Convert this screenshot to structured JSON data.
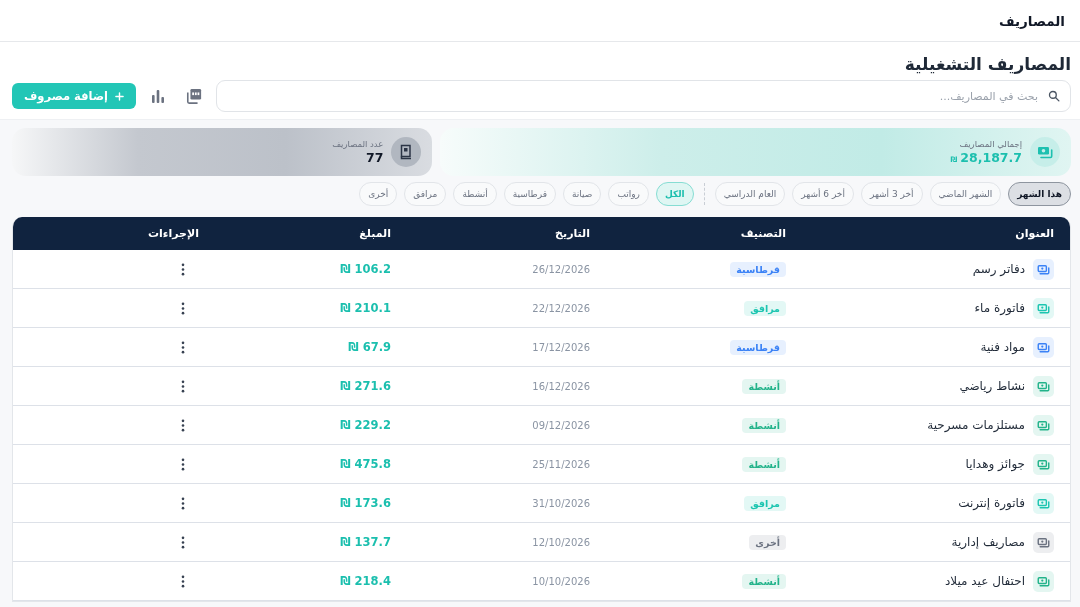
{
  "top_bar": {
    "title": "المصاريف"
  },
  "page": {
    "title": "المصاريف التشغيلية"
  },
  "toolbar": {
    "search": {
      "placeholder": "بحث في المصاريف..."
    },
    "add_button": "إضافة مصروف"
  },
  "stats": [
    {
      "kind": "total",
      "label": "إجمالي المصاريف",
      "value": "28,187.7",
      "currency": "₪"
    },
    {
      "kind": "count",
      "label": "عدد المصاريف",
      "value": "77"
    }
  ],
  "period_filters": [
    {
      "label": "هذا الشهر",
      "selected": true
    },
    {
      "label": "الشهر الماضي",
      "selected": false
    },
    {
      "label": "أخر 3 أشهر",
      "selected": false
    },
    {
      "label": "أخر 6 أشهر",
      "selected": false
    },
    {
      "label": "العام الدراسي",
      "selected": false
    }
  ],
  "category_filters": [
    {
      "label": "الكل",
      "selected": true
    },
    {
      "label": "رواتب",
      "selected": false
    },
    {
      "label": "صيانة",
      "selected": false
    },
    {
      "label": "قرطاسية",
      "selected": false
    },
    {
      "label": "أنشطة",
      "selected": false
    },
    {
      "label": "مرافق",
      "selected": false
    },
    {
      "label": "أخرى",
      "selected": false
    }
  ],
  "table": {
    "columns": [
      "العنوان",
      "التصنيف",
      "التاريخ",
      "المبلغ",
      "الإجراءات"
    ],
    "rows": [
      {
        "title": "دفاتر رسم",
        "category": "قرطاسية",
        "color": "#3b82f6",
        "date": "26/12/2026",
        "amount": "106.2 ₪"
      },
      {
        "title": "فاتورة ماء",
        "category": "مرافق",
        "color": "#1cc5b0",
        "date": "22/12/2026",
        "amount": "210.1 ₪"
      },
      {
        "title": "مواد فنية",
        "category": "قرطاسية",
        "color": "#3b82f6",
        "date": "17/12/2026",
        "amount": "67.9 ₪"
      },
      {
        "title": "نشاط رياضي",
        "category": "أنشطة",
        "color": "#22b38a",
        "date": "16/12/2026",
        "amount": "271.6 ₪"
      },
      {
        "title": "مستلزمات مسرحية",
        "category": "أنشطة",
        "color": "#22b38a",
        "date": "09/12/2026",
        "amount": "229.2 ₪"
      },
      {
        "title": "جوائز وهدايا",
        "category": "أنشطة",
        "color": "#22b38a",
        "date": "25/11/2026",
        "amount": "475.8 ₪"
      },
      {
        "title": "فاتورة إنترنت",
        "category": "مرافق",
        "color": "#1cc5b0",
        "date": "31/10/2026",
        "amount": "173.6 ₪"
      },
      {
        "title": "مصاريف إدارية",
        "category": "أخرى",
        "color": "#6b7280",
        "date": "12/10/2026",
        "amount": "137.7 ₪"
      },
      {
        "title": "احتفال عيد ميلاد",
        "category": "أنشطة",
        "color": "#22b38a",
        "date": "10/10/2026",
        "amount": "218.4 ₪"
      }
    ]
  }
}
